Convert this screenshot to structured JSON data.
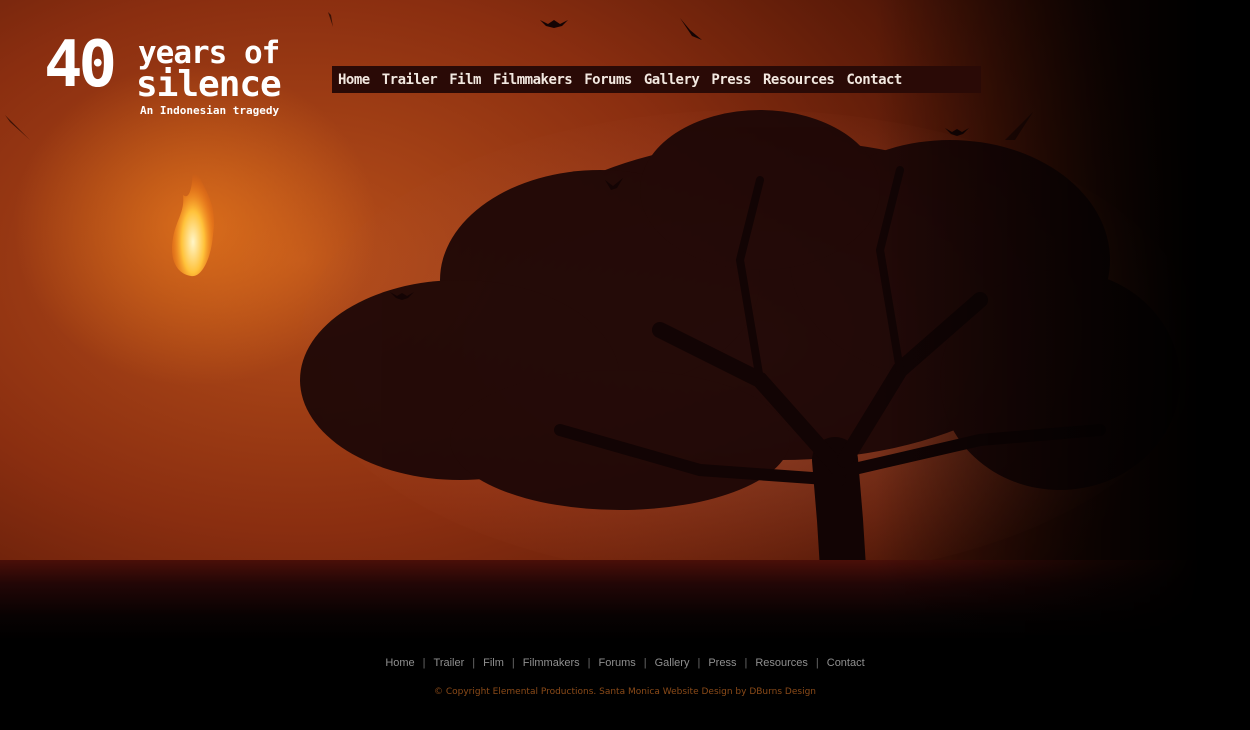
{
  "logo": {
    "number": "40",
    "line1": "years of",
    "line2": "silence",
    "tagline": "An Indonesian tragedy"
  },
  "top_nav": [
    {
      "label": "Home"
    },
    {
      "label": "Trailer"
    },
    {
      "label": "Film"
    },
    {
      "label": "Filmmakers"
    },
    {
      "label": "Forums"
    },
    {
      "label": "Gallery"
    },
    {
      "label": "Press"
    },
    {
      "label": "Resources"
    },
    {
      "label": "Contact"
    }
  ],
  "footer_nav": [
    {
      "label": "Home"
    },
    {
      "label": "Trailer"
    },
    {
      "label": "Film"
    },
    {
      "label": "Filmmakers"
    },
    {
      "label": "Forums"
    },
    {
      "label": "Gallery"
    },
    {
      "label": "Press"
    },
    {
      "label": "Resources"
    },
    {
      "label": "Contact"
    }
  ],
  "footer_separator": "|",
  "copyright": "© Copyright Elemental Productions. Santa Monica Website Design by DBurns Design",
  "colors": {
    "sky": "#8a2e10",
    "nav_bg": "#2a0a06",
    "copyright": "#8a4a18",
    "footer_link": "#8f8f8f"
  }
}
